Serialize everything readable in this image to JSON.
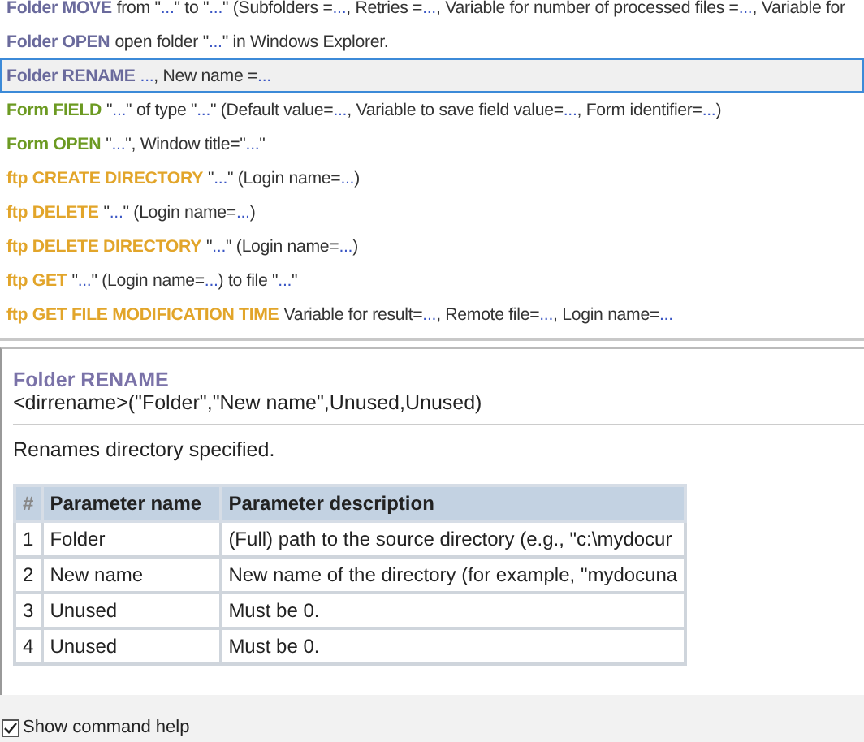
{
  "commands": [
    {
      "name": "Folder MOVE",
      "color": "#6a6a9c",
      "selected": false,
      "params": [
        {
          "kind": "text",
          "text": "from \""
        },
        {
          "kind": "value",
          "text": "..."
        },
        {
          "kind": "text",
          "text": "\" to \""
        },
        {
          "kind": "value",
          "text": "..."
        },
        {
          "kind": "text",
          "text": "\" (Subfolders = "
        },
        {
          "kind": "value",
          "text": "..."
        },
        {
          "kind": "text",
          "text": ", Retries = "
        },
        {
          "kind": "value",
          "text": "..."
        },
        {
          "kind": "text",
          "text": ", Variable for number of processed files = "
        },
        {
          "kind": "value",
          "text": "..."
        },
        {
          "kind": "text",
          "text": ", Variable for"
        }
      ]
    },
    {
      "name": "Folder OPEN",
      "color": "#6a6a9c",
      "selected": false,
      "params": [
        {
          "kind": "text",
          "text": "open folder \""
        },
        {
          "kind": "value",
          "text": "..."
        },
        {
          "kind": "text",
          "text": "\" in Windows Explorer."
        }
      ]
    },
    {
      "name": "Folder RENAME",
      "color": "#6a6a9c",
      "selected": true,
      "params": [
        {
          "kind": "value",
          "text": "..."
        },
        {
          "kind": "text",
          "text": ", New name = "
        },
        {
          "kind": "value",
          "text": "..."
        }
      ]
    },
    {
      "name": "Form FIELD",
      "color": "#6c9a22",
      "selected": false,
      "params": [
        {
          "kind": "text",
          "text": "\""
        },
        {
          "kind": "value",
          "text": "..."
        },
        {
          "kind": "text",
          "text": "\" of type \""
        },
        {
          "kind": "value",
          "text": "..."
        },
        {
          "kind": "text",
          "text": "\" (Default value="
        },
        {
          "kind": "value",
          "text": "..."
        },
        {
          "kind": "text",
          "text": ", Variable to save field value="
        },
        {
          "kind": "value",
          "text": "..."
        },
        {
          "kind": "text",
          "text": ", Form identifier="
        },
        {
          "kind": "value",
          "text": "..."
        },
        {
          "kind": "text",
          "text": ")"
        }
      ]
    },
    {
      "name": "Form OPEN",
      "color": "#6c9a22",
      "selected": false,
      "params": [
        {
          "kind": "text",
          "text": "\""
        },
        {
          "kind": "value",
          "text": "..."
        },
        {
          "kind": "text",
          "text": "\", Window title=\""
        },
        {
          "kind": "value",
          "text": "..."
        },
        {
          "kind": "text",
          "text": "\""
        }
      ]
    },
    {
      "name": "ftp CREATE DIRECTORY",
      "color": "#e2a52a",
      "selected": false,
      "params": [
        {
          "kind": "text",
          "text": "\""
        },
        {
          "kind": "value",
          "text": "..."
        },
        {
          "kind": "text",
          "text": "\" (Login name="
        },
        {
          "kind": "value",
          "text": "..."
        },
        {
          "kind": "text",
          "text": ")"
        }
      ]
    },
    {
      "name": "ftp DELETE",
      "color": "#e2a52a",
      "selected": false,
      "params": [
        {
          "kind": "text",
          "text": "\""
        },
        {
          "kind": "value",
          "text": "..."
        },
        {
          "kind": "text",
          "text": "\" (Login name="
        },
        {
          "kind": "value",
          "text": "..."
        },
        {
          "kind": "text",
          "text": ")"
        }
      ]
    },
    {
      "name": "ftp DELETE DIRECTORY",
      "color": "#e2a52a",
      "selected": false,
      "params": [
        {
          "kind": "text",
          "text": "\""
        },
        {
          "kind": "value",
          "text": "..."
        },
        {
          "kind": "text",
          "text": "\" (Login name="
        },
        {
          "kind": "value",
          "text": "..."
        },
        {
          "kind": "text",
          "text": ")"
        }
      ]
    },
    {
      "name": "ftp GET",
      "color": "#e2a52a",
      "selected": false,
      "params": [
        {
          "kind": "text",
          "text": "\""
        },
        {
          "kind": "value",
          "text": "..."
        },
        {
          "kind": "text",
          "text": "\" (Login name="
        },
        {
          "kind": "value",
          "text": "..."
        },
        {
          "kind": "text",
          "text": ") to file \""
        },
        {
          "kind": "value",
          "text": "..."
        },
        {
          "kind": "text",
          "text": "\""
        }
      ]
    },
    {
      "name": "ftp GET FILE MODIFICATION TIME",
      "color": "#e2a52a",
      "selected": false,
      "params": [
        {
          "kind": "text",
          "text": "Variable for result="
        },
        {
          "kind": "value",
          "text": "..."
        },
        {
          "kind": "text",
          "text": ", Remote file="
        },
        {
          "kind": "value",
          "text": "..."
        },
        {
          "kind": "text",
          "text": ", Login name="
        },
        {
          "kind": "value",
          "text": "..."
        }
      ]
    }
  ],
  "help": {
    "title": "Folder RENAME",
    "syntax": "<dirrename>(\"Folder\",\"New name\",Unused,Unused)",
    "description": "Renames directory specified.",
    "table": {
      "columns": [
        "#",
        "Parameter name",
        "Parameter description"
      ],
      "rows": [
        [
          "1",
          "Folder",
          "(Full) path to the source directory (e.g., \"c:\\mydocur"
        ],
        [
          "2",
          "New name",
          "New name of the directory (for example, \"mydocuna"
        ],
        [
          "3",
          "Unused",
          "Must be 0."
        ],
        [
          "4",
          "Unused",
          "Must be 0."
        ]
      ]
    }
  },
  "show_help": {
    "label": "Show command help",
    "checked": true
  }
}
